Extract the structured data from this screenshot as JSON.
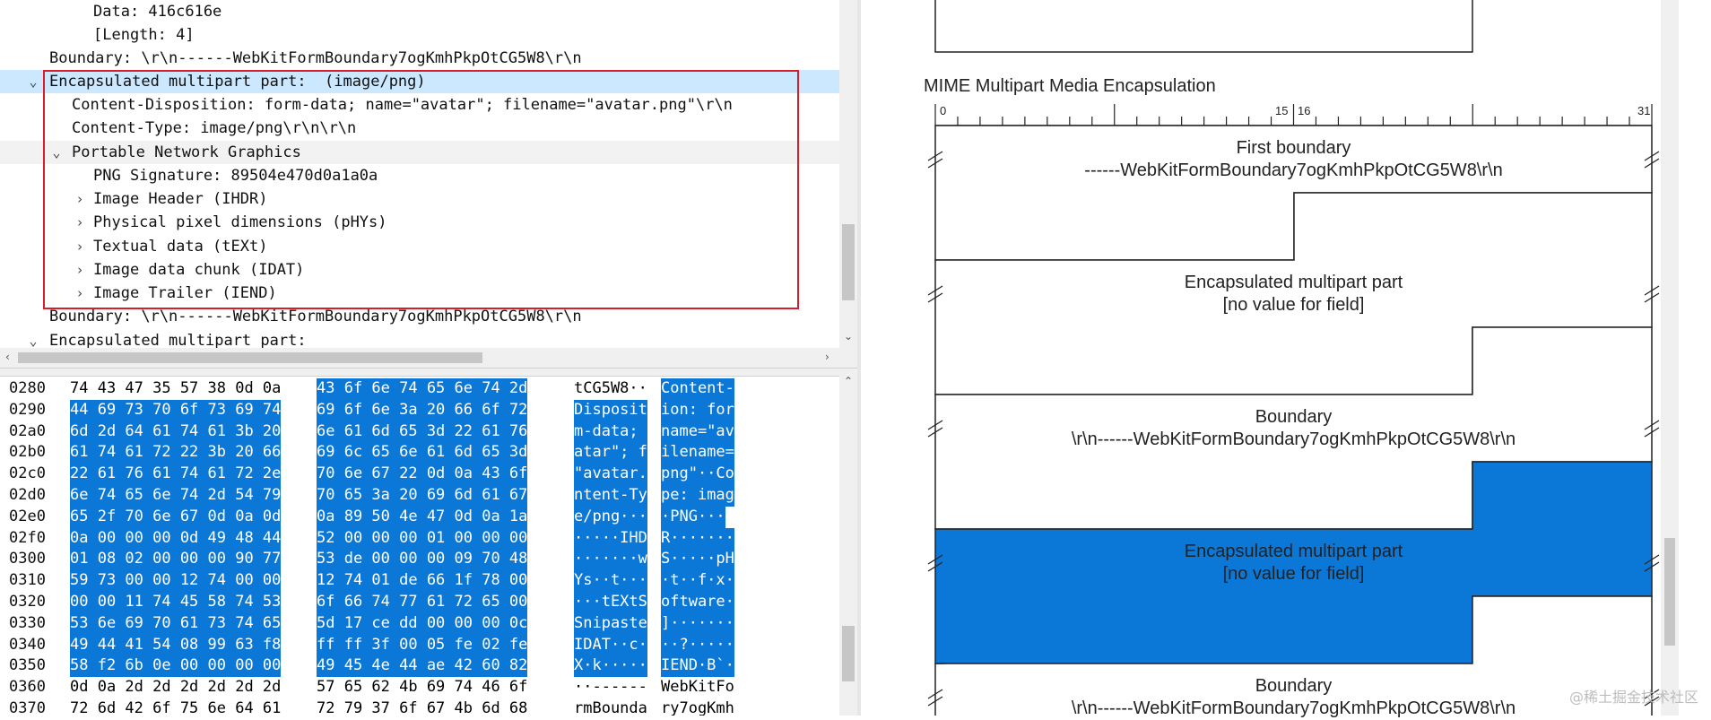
{
  "tree": {
    "rows": [
      {
        "text": "Data: 416c616e"
      },
      {
        "text": "[Length: 4]"
      },
      {
        "text": "Boundary: \\r\\n------WebKitFormBoundary7ogKmhPkpOtCG5W8\\r\\n"
      },
      {
        "text": "Encapsulated multipart part:  (image/png)"
      },
      {
        "text": "Content-Disposition: form-data; name=\"avatar\"; filename=\"avatar.png\"\\r\\n"
      },
      {
        "text": "Content-Type: image/png\\r\\n\\r\\n"
      },
      {
        "text": "Portable Network Graphics"
      },
      {
        "text": "PNG Signature: 89504e470d0a1a0a"
      },
      {
        "text": "Image Header (IHDR)"
      },
      {
        "text": "Physical pixel dimensions (pHYs)"
      },
      {
        "text": "Textual data (tEXt)"
      },
      {
        "text": "Image data chunk (IDAT)"
      },
      {
        "text": "Image Trailer (IEND)"
      },
      {
        "text": "Boundary: \\r\\n------WebKitFormBoundary7ogKmhPkpOtCG5W8\\r\\n"
      },
      {
        "text": "Encapsulated multipart part:"
      }
    ]
  },
  "hex": {
    "rows": [
      {
        "off": "0280",
        "b1": "74 43 47 35 57 38 0d 0a",
        "b2": "43 6f 6e 74 65 6e 74 2d",
        "a1": "tCG5W8··",
        "a2": "Content-"
      },
      {
        "off": "0290",
        "b1": "44 69 73 70 6f 73 69 74",
        "b2": "69 6f 6e 3a 20 66 6f 72",
        "a1": "Disposit",
        "a2": "ion: for"
      },
      {
        "off": "02a0",
        "b1": "6d 2d 64 61 74 61 3b 20",
        "b2": "6e 61 6d 65 3d 22 61 76",
        "a1": "m-data; ",
        "a2": "name=\"av"
      },
      {
        "off": "02b0",
        "b1": "61 74 61 72 22 3b 20 66",
        "b2": "69 6c 65 6e 61 6d 65 3d",
        "a1": "atar\"; f",
        "a2": "ilename="
      },
      {
        "off": "02c0",
        "b1": "22 61 76 61 74 61 72 2e",
        "b2": "70 6e 67 22 0d 0a 43 6f",
        "a1": "\"avatar.",
        "a2": "png\"··Co"
      },
      {
        "off": "02d0",
        "b1": "6e 74 65 6e 74 2d 54 79",
        "b2": "70 65 3a 20 69 6d 61 67",
        "a1": "ntent-Ty",
        "a2": "pe: imag"
      },
      {
        "off": "02e0",
        "b1": "65 2f 70 6e 67 0d 0a 0d",
        "b2": "0a 89 50 4e 47 0d 0a 1a",
        "a1": "e/png···",
        "a2": "·PNG···"
      },
      {
        "off": "02f0",
        "b1": "0a 00 00 00 0d 49 48 44",
        "b2": "52 00 00 00 01 00 00 00",
        "a1": "·····IHD",
        "a2": "R·······"
      },
      {
        "off": "0300",
        "b1": "01 08 02 00 00 00 90 77",
        "b2": "53 de 00 00 00 09 70 48",
        "a1": "·······w",
        "a2": "S·····pH"
      },
      {
        "off": "0310",
        "b1": "59 73 00 00 12 74 00 00",
        "b2": "12 74 01 de 66 1f 78 00",
        "a1": "Ys··t···",
        "a2": "·t··f·x·"
      },
      {
        "off": "0320",
        "b1": "00 00 11 74 45 58 74 53",
        "b2": "6f 66 74 77 61 72 65 00",
        "a1": "···tEXtS",
        "a2": "oftware·"
      },
      {
        "off": "0330",
        "b1": "53 6e 69 70 61 73 74 65",
        "b2": "5d 17 ce dd 00 00 00 0c",
        "a1": "Snipaste",
        "a2": "]·······"
      },
      {
        "off": "0340",
        "b1": "49 44 41 54 08 99 63 f8",
        "b2": "ff ff 3f 00 05 fe 02 fe",
        "a1": "IDAT··c·",
        "a2": "··?·····"
      },
      {
        "off": "0350",
        "b1": "58 f2 6b 0e 00 00 00 00",
        "b2": "49 45 4e 44 ae 42 60 82",
        "a1": "X·k·····",
        "a2": "IEND·B`·"
      },
      {
        "off": "0360",
        "b1": "0d 0a 2d 2d 2d 2d 2d 2d",
        "b2": "57 65 62 4b 69 74 46 6f",
        "a1": "··------",
        "a2": "WebKitFo"
      },
      {
        "off": "0370",
        "b1": "72 6d 42 6f 75 6e 64 61",
        "b2": "72 79 37 6f 67 4b 6d 68",
        "a1": "rmBounda",
        "a2": "ry7ogKmh"
      }
    ]
  },
  "diagram": {
    "title": "MIME Multipart Media Encapsulation",
    "ticks": [
      "0",
      "15",
      "16",
      "31"
    ],
    "fields": [
      {
        "line1": "First boundary",
        "line2": "------WebKitFormBoundary7ogKmhPkpOtCG5W8\\r\\n"
      },
      {
        "line1": "Encapsulated multipart part",
        "line2": "[no value for field]"
      },
      {
        "line1": "Boundary",
        "line2": "\\r\\n------WebKitFormBoundary7ogKmhPkpOtCG5W8\\r\\n"
      },
      {
        "line1": "Encapsulated multipart part",
        "line2": "[no value for field]"
      },
      {
        "line1": "Boundary",
        "line2": "\\r\\n------WebKitFormBoundary7ogKmhPkpOtCG5W8\\r\\n"
      }
    ]
  },
  "watermark": "@稀土掘金技术社区",
  "colors": {
    "selection": "#0b78d7",
    "row_highlight": "#cce8ff",
    "red_box": "#d81e2a"
  }
}
